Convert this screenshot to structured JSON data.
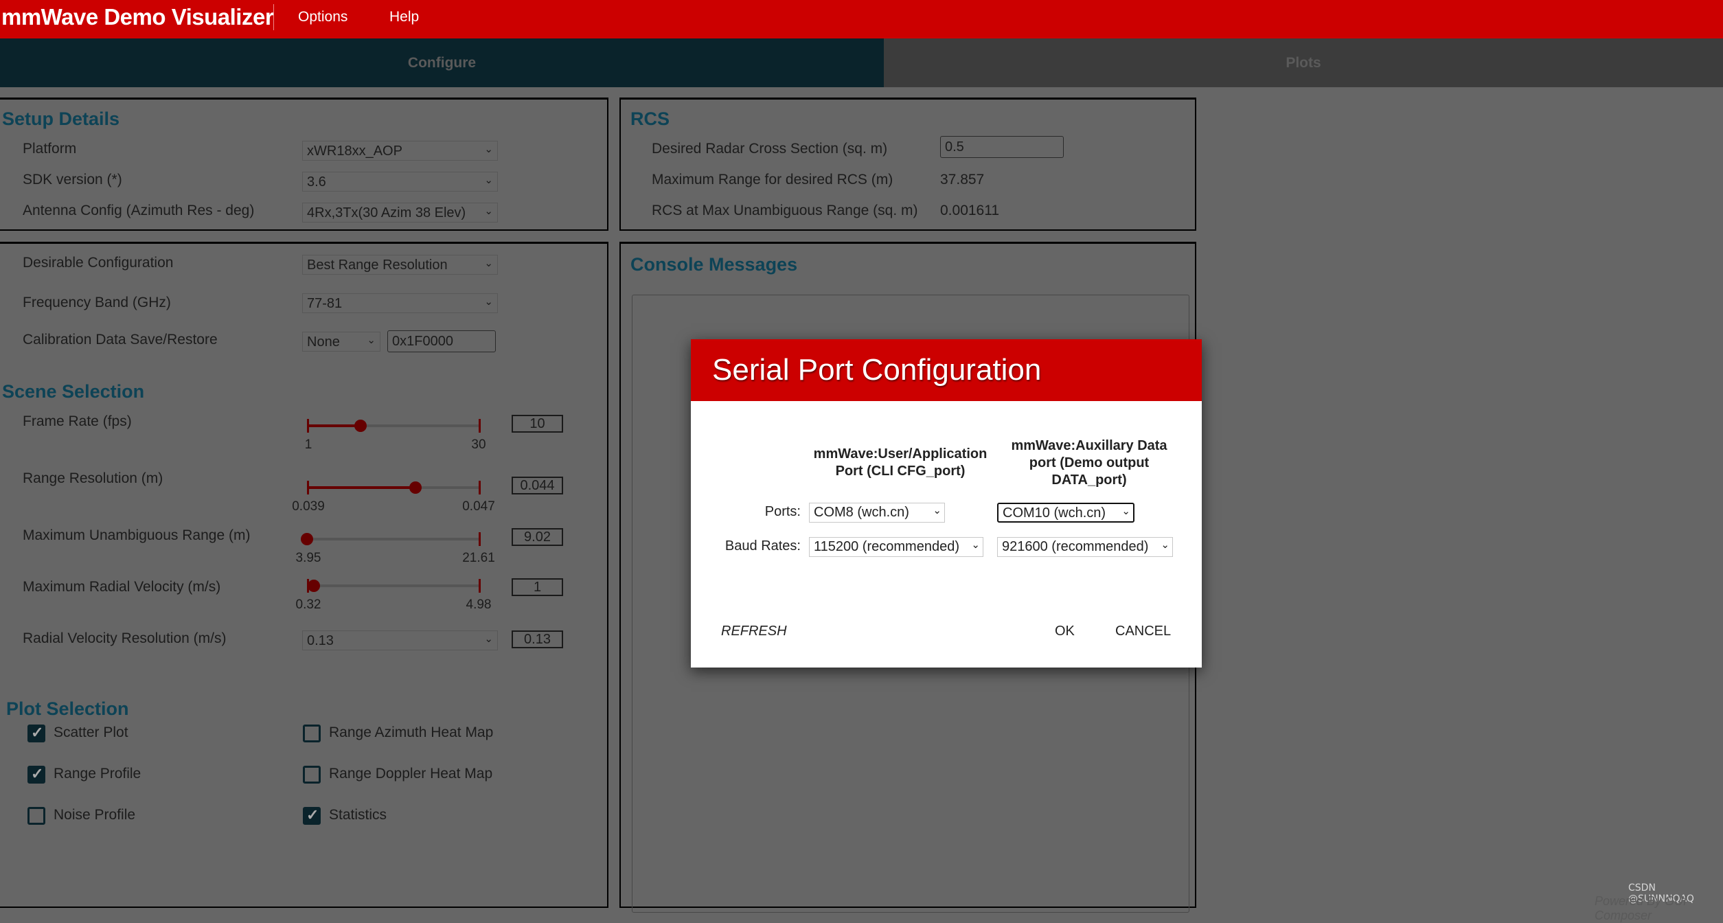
{
  "app": {
    "title": "mmWave Demo Visualizer",
    "menu": [
      "Options",
      "Help"
    ]
  },
  "tabs": [
    {
      "label": "Configure",
      "active": true
    },
    {
      "label": "Plots",
      "active": false
    }
  ],
  "setup": {
    "title": "Setup Details",
    "platform": {
      "label": "Platform",
      "value": "xWR18xx_AOP"
    },
    "sdk": {
      "label": "SDK version (*)",
      "value": "3.6"
    },
    "antenna": {
      "label": "Antenna Config (Azimuth Res - deg)",
      "value": "4Rx,3Tx(30 Azim 38 Elev)"
    }
  },
  "config": {
    "desirable": {
      "label": "Desirable Configuration",
      "value": "Best Range Resolution"
    },
    "freq": {
      "label": "Frequency Band (GHz)",
      "value": "77-81"
    },
    "calib": {
      "label": "Calibration Data Save/Restore",
      "value": "None",
      "address": "0x1F0000"
    }
  },
  "scene": {
    "title": "Scene Selection",
    "sliders": [
      {
        "label": "Frame Rate (fps)",
        "min": 1,
        "max": 30,
        "value": 10,
        "display": "10",
        "min_label": "1",
        "max_label": "30",
        "fill_from_min": true
      },
      {
        "label": "Range Resolution (m)",
        "min": 0.039,
        "max": 0.047,
        "value": 0.044,
        "display": "0.044",
        "min_label": "0.039",
        "max_label": "0.047",
        "fill_from_min": true
      },
      {
        "label": "Maximum Unambiguous Range (m)",
        "min": 3.95,
        "max": 21.61,
        "value": 3.95,
        "display": "9.02",
        "min_label": "3.95",
        "max_label": "21.61",
        "fill_from_min": false
      },
      {
        "label": "Maximum Radial Velocity (m/s)",
        "min": 0.32,
        "max": 4.98,
        "value": 0.51,
        "display": "1",
        "min_label": "0.32",
        "max_label": "4.98",
        "fill_from_min": true
      }
    ],
    "velres": {
      "label": "Radial Velocity Resolution (m/s)",
      "value": "0.13",
      "display": "0.13"
    }
  },
  "plots": {
    "title": "Plot Selection",
    "items": [
      {
        "label": "Scatter Plot",
        "checked": true
      },
      {
        "label": "Range Profile",
        "checked": true
      },
      {
        "label": "Noise Profile",
        "checked": false
      },
      {
        "label": "Range Azimuth Heat Map",
        "checked": false
      },
      {
        "label": "Range Doppler Heat Map",
        "checked": false
      },
      {
        "label": "Statistics",
        "checked": true
      }
    ]
  },
  "rcs": {
    "title": "RCS",
    "desired": {
      "label": "Desired Radar Cross Section (sq. m)",
      "value": "0.5"
    },
    "maxrange": {
      "label": "Maximum Range for desired RCS (m)",
      "value": "37.857"
    },
    "rcsmax": {
      "label": "RCS at Max Unambiguous Range (sq. m)",
      "value": "0.001611"
    }
  },
  "console": {
    "title": "Console Messages"
  },
  "dialog": {
    "title": "Serial Port Configuration",
    "col1": "mmWave:User/Application Port (CLI CFG_port)",
    "col2": "mmWave:Auxillary Data port (Demo output DATA_port)",
    "ports_label": "Ports:",
    "baud_label": "Baud Rates:",
    "cfg_port": "COM8 (wch.cn)",
    "data_port": "COM10 (wch.cn)",
    "cfg_baud": "115200 (recommended)",
    "data_baud": "921600 (recommended)",
    "refresh": "REFRESH",
    "ok": "OK",
    "cancel": "CANCEL"
  },
  "footer": {
    "watermark": "CSDN @SUNNNQAQ",
    "powered": "Powered By GUI Composer"
  },
  "colors": {
    "brand_red": "#cc0000",
    "section_title": "#0d4356",
    "slider": "#660000"
  }
}
